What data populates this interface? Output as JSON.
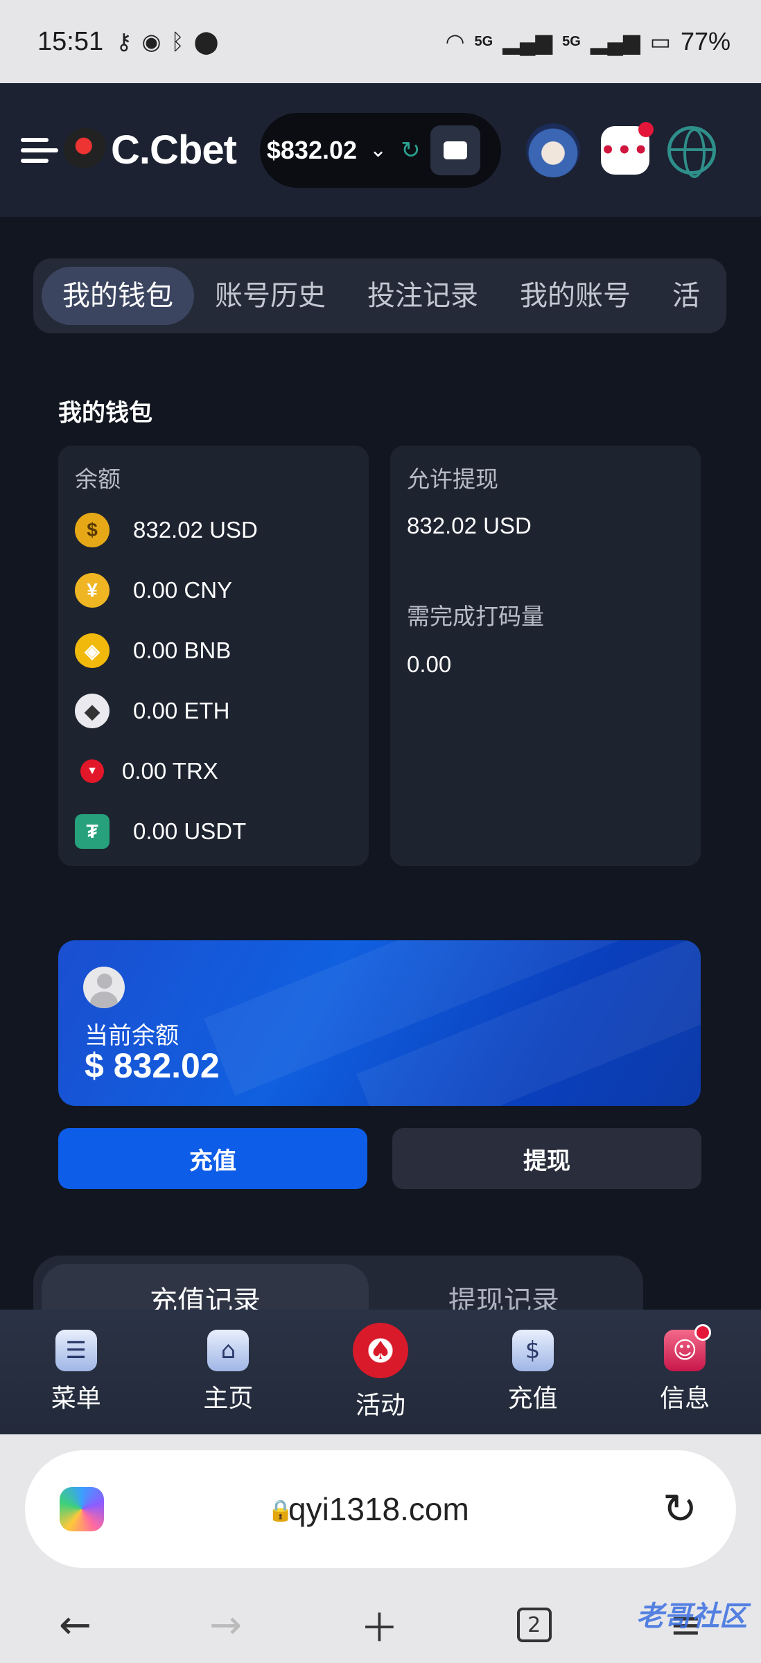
{
  "status": {
    "time": "15:51",
    "battery": "77%",
    "net1": "5G",
    "net2": "5G"
  },
  "header": {
    "brand": "C.Cbet",
    "balance": "$832.02"
  },
  "tabs": [
    "我的钱包",
    "账号历史",
    "投注记录",
    "我的账号",
    "活"
  ],
  "wallet": {
    "title": "我的钱包",
    "balance_label": "余额",
    "coins": [
      {
        "symbol": "$",
        "value": "832.02 USD",
        "color": "#e6a817"
      },
      {
        "symbol": "¥",
        "value": "0.00 CNY",
        "color": "#efb522"
      },
      {
        "symbol": "◈",
        "value": "0.00 BNB",
        "color": "#f0b90b"
      },
      {
        "symbol": "◆",
        "value": "0.00 ETH",
        "color": "#e9e9ee"
      },
      {
        "symbol": "▼",
        "value": "0.00 TRX",
        "color": "#e3172a"
      },
      {
        "symbol": "₮",
        "value": "0.00 USDT",
        "color": "#26a17b"
      }
    ],
    "withdraw_label": "允许提现",
    "withdraw_value": "832.02 USD",
    "wager_label": "需完成打码量",
    "wager_value": "0.00"
  },
  "balance_card": {
    "label": "当前余额",
    "amount": "$ 832.02"
  },
  "actions": {
    "deposit": "充值",
    "withdraw": "提现"
  },
  "records": {
    "deposit_tab": "充值记录",
    "withdraw_tab": "提现记录"
  },
  "bottom_nav": [
    {
      "label": "菜单",
      "icon": "menu-icon"
    },
    {
      "label": "主页",
      "icon": "home-icon"
    },
    {
      "label": "活动",
      "icon": "chip-icon"
    },
    {
      "label": "充值",
      "icon": "deposit-icon"
    },
    {
      "label": "信息",
      "icon": "message-icon"
    }
  ],
  "browser": {
    "url": "qyi1318.com",
    "tab_count": "2"
  },
  "watermark": "老哥社区"
}
